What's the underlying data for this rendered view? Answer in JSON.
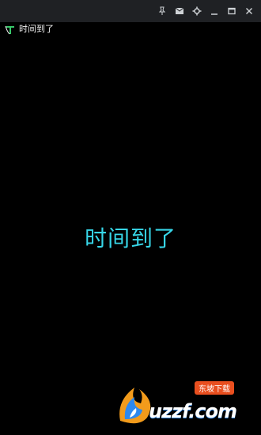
{
  "window": {
    "title": "时间到了",
    "controls": {
      "pin_icon": "pin-icon",
      "mail_icon": "mail-icon",
      "settings_icon": "gear-icon",
      "minimize_icon": "minimize-icon",
      "maximize_icon": "maximize-icon",
      "close_icon": "close-icon"
    }
  },
  "main": {
    "message": "时间到了"
  },
  "watermark": {
    "text": "uzzf.com",
    "badge": "东坡下载"
  },
  "colors": {
    "background": "#000000",
    "titlebar": "#1f2124",
    "message": "#37d6e8",
    "logo_green": "#38c86a"
  }
}
